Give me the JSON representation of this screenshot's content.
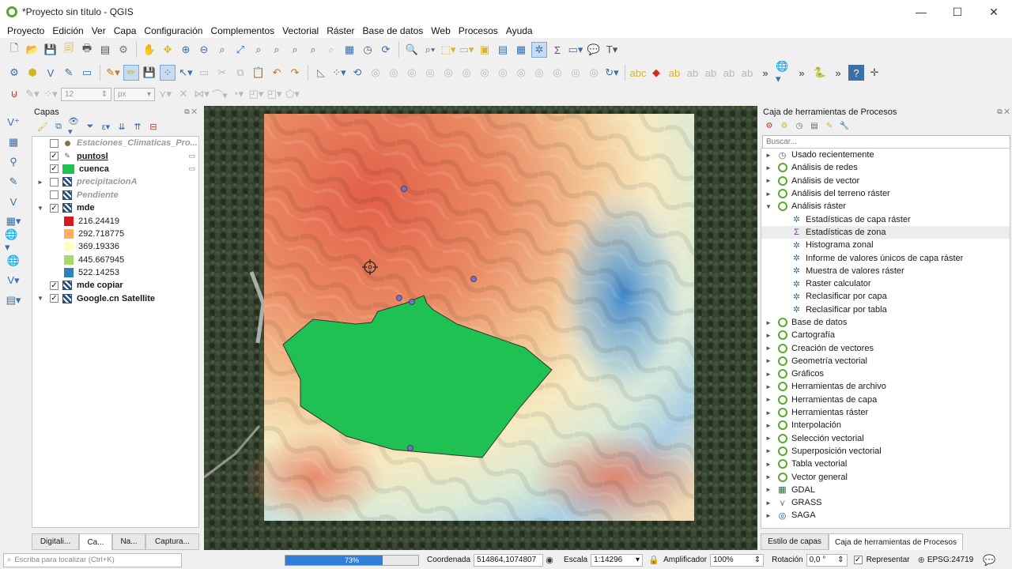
{
  "window": {
    "title": "*Proyecto sin título - QGIS",
    "controls": [
      "—",
      "☐",
      "✕"
    ]
  },
  "menu": [
    "Proyecto",
    "Edición",
    "Ver",
    "Capa",
    "Configuración",
    "Complementos",
    "Vectorial",
    "Ráster",
    "Base de datos",
    "Web",
    "Procesos",
    "Ayuda"
  ],
  "toolbar3": {
    "font_size": "12",
    "font_unit": "px"
  },
  "layers_panel": {
    "title": "Capas",
    "layers": [
      {
        "name": "Estaciones_Climaticas_Pro...",
        "style": "italic",
        "checked": false,
        "icon": "point-dot-icon",
        "expand": ""
      },
      {
        "name": "puntosl",
        "style": "bold-underline",
        "checked": true,
        "icon": "pencil-icon",
        "expand": ""
      },
      {
        "name": "cuenca",
        "style": "bold",
        "checked": true,
        "icon": "polygon-green-icon",
        "expand": ""
      },
      {
        "name": "precipitacionA",
        "style": "italic",
        "checked": false,
        "icon": "raster-icon",
        "expand": "►"
      },
      {
        "name": "Pendiente",
        "style": "italic",
        "checked": false,
        "icon": "raster-icon",
        "expand": ""
      },
      {
        "name": "mde",
        "style": "bold",
        "checked": true,
        "icon": "raster-icon",
        "expand": "▼"
      }
    ],
    "legend": [
      {
        "value": "216.24419",
        "color": "#d7191c"
      },
      {
        "value": "292.718775",
        "color": "#fdae61"
      },
      {
        "value": "369.19336",
        "color": "#ffffbf"
      },
      {
        "value": "445.667945",
        "color": "#a6d96a"
      },
      {
        "value": "522.14253",
        "color": "#2b83ba"
      }
    ],
    "layers_after": [
      {
        "name": "mde copiar",
        "style": "bold",
        "checked": true,
        "icon": "raster-icon",
        "expand": ""
      },
      {
        "name": "Google.cn Satellite",
        "style": "bold",
        "checked": true,
        "icon": "raster-icon",
        "expand": "▼"
      }
    ],
    "tabs": [
      "Digitali...",
      "Ca...",
      "Na...",
      "Captura..."
    ]
  },
  "processing": {
    "title": "Caja de herramientas de Procesos",
    "search_placeholder": "Buscar...",
    "items": [
      {
        "label": "Usado recientemente",
        "level": 0,
        "expand": "►",
        "icon": "clock-icon"
      },
      {
        "label": "Análisis de redes",
        "level": 0,
        "expand": "►",
        "icon": "qgis-icon"
      },
      {
        "label": "Análisis de vector",
        "level": 0,
        "expand": "►",
        "icon": "qgis-icon"
      },
      {
        "label": "Análisis del terreno ráster",
        "level": 0,
        "expand": "►",
        "icon": "qgis-icon"
      },
      {
        "label": "Análisis ráster",
        "level": 0,
        "expand": "▼",
        "icon": "qgis-icon"
      },
      {
        "label": "Estadísticas de capa ráster",
        "level": 1,
        "expand": "",
        "icon": "gear-icon"
      },
      {
        "label": "Estadísticas de zona",
        "level": 1,
        "expand": "",
        "icon": "zonal-icon"
      },
      {
        "label": "Histograma zonal",
        "level": 1,
        "expand": "",
        "icon": "gear-icon"
      },
      {
        "label": "Informe de valores únicos de capa ráster",
        "level": 1,
        "expand": "",
        "icon": "gear-icon"
      },
      {
        "label": "Muestra de valores ráster",
        "level": 1,
        "expand": "",
        "icon": "gear-icon"
      },
      {
        "label": "Raster calculator",
        "level": 1,
        "expand": "",
        "icon": "gear-icon"
      },
      {
        "label": "Reclasificar por capa",
        "level": 1,
        "expand": "",
        "icon": "gear-icon"
      },
      {
        "label": "Reclasificar por tabla",
        "level": 1,
        "expand": "",
        "icon": "gear-icon"
      },
      {
        "label": "Base de datos",
        "level": 0,
        "expand": "►",
        "icon": "qgis-icon"
      },
      {
        "label": "Cartografía",
        "level": 0,
        "expand": "►",
        "icon": "qgis-icon"
      },
      {
        "label": "Creación de vectores",
        "level": 0,
        "expand": "►",
        "icon": "qgis-icon"
      },
      {
        "label": "Geometría vectorial",
        "level": 0,
        "expand": "►",
        "icon": "qgis-icon"
      },
      {
        "label": "Gráficos",
        "level": 0,
        "expand": "►",
        "icon": "qgis-icon"
      },
      {
        "label": "Herramientas de archivo",
        "level": 0,
        "expand": "►",
        "icon": "qgis-icon"
      },
      {
        "label": "Herramientas de capa",
        "level": 0,
        "expand": "►",
        "icon": "qgis-icon"
      },
      {
        "label": "Herramientas ráster",
        "level": 0,
        "expand": "►",
        "icon": "qgis-icon"
      },
      {
        "label": "Interpolación",
        "level": 0,
        "expand": "►",
        "icon": "qgis-icon"
      },
      {
        "label": "Selección vectorial",
        "level": 0,
        "expand": "►",
        "icon": "qgis-icon"
      },
      {
        "label": "Superposición vectorial",
        "level": 0,
        "expand": "►",
        "icon": "qgis-icon"
      },
      {
        "label": "Tabla vectorial",
        "level": 0,
        "expand": "►",
        "icon": "qgis-icon"
      },
      {
        "label": "Vector general",
        "level": 0,
        "expand": "►",
        "icon": "qgis-icon"
      },
      {
        "label": "GDAL",
        "level": 0,
        "expand": "►",
        "icon": "gdal-icon"
      },
      {
        "label": "GRASS",
        "level": 0,
        "expand": "►",
        "icon": "grass-icon"
      },
      {
        "label": "SAGA",
        "level": 0,
        "expand": "►",
        "icon": "saga-icon"
      }
    ],
    "tabs": [
      "Estilo de capas",
      "Caja de herramientas de Procesos"
    ]
  },
  "status": {
    "locator_placeholder": "Escriba para localizar (Ctrl+K)",
    "progress_percent": 73,
    "progress_text": "73%",
    "coord_label": "Coordenada",
    "coord_value": "514864,1074807",
    "scale_label": "Escala",
    "scale_value": "1:14296",
    "magnifier_label": "Amplificador",
    "magnifier_value": "100%",
    "rotation_label": "Rotación",
    "rotation_value": "0,0 °",
    "render_label": "Representar",
    "crs": "EPSG:24719"
  },
  "colors": {
    "accent": "#2f7ed8",
    "qgis_green": "#5aa732",
    "basin_fill": "#1fc152"
  }
}
